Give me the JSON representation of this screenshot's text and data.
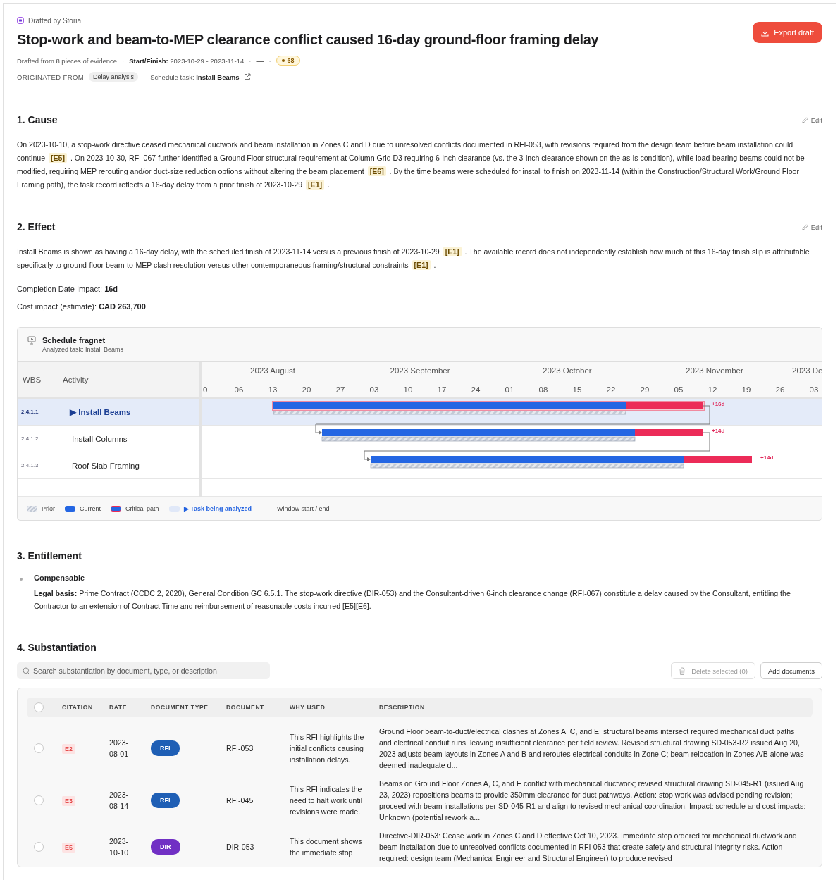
{
  "header": {
    "drafted_by": "Drafted by Storia",
    "title": "Stop-work and beam-to-MEP clearance conflict caused 16-day ground-floor framing delay",
    "export_button": "Export draft",
    "separator": "·",
    "meta": {
      "evidence": "Drafted from 8 pieces of evidence",
      "dates_label": "Start/Finish:",
      "dates": "2023-10-29 - 2023-11-14",
      "dash": "—",
      "score": "68"
    },
    "origin": {
      "label": "ORIGINATED FROM",
      "chip": "Delay analysis",
      "task_label": "Schedule task:",
      "task": "Install Beams"
    }
  },
  "sections": [
    {
      "kind": "text",
      "heading": "1. Cause",
      "edit": "Edit",
      "body": [
        {
          "text": "On 2023-10-10, a stop-work directive ceased mechanical ductwork and beam installation in Zones C and D due to unresolved conflicts documented in RFI-053, with revisions required from the design team before beam installation could continue "
        },
        {
          "cite": "[E5]"
        },
        {
          "text": " . On 2023-10-30, RFI-067 further identified a Ground Floor structural requirement at Column Grid D3 requiring 6-inch clearance (vs. the 3-inch clearance shown on the as-is condition), while load-bearing beams could not be modified, requiring MEP rerouting and/or duct-size reduction options without altering the beam placement "
        },
        {
          "cite": "[E6]"
        },
        {
          "text": " . By the time beams were scheduled for install to finish on 2023-11-14 (within the Construction/Structural Work/Ground Floor Framing path), the task record reflects a 16-day delay from a prior finish of 2023-10-29 "
        },
        {
          "cite": "[E1]"
        },
        {
          "text": " ."
        }
      ]
    },
    {
      "kind": "effect",
      "heading": "2. Effect",
      "edit": "Edit",
      "body": [
        {
          "text": "Install Beams is shown as having a 16-day delay, with the scheduled finish of 2023-11-14 versus a previous finish of 2023-10-29 "
        },
        {
          "cite": "[E1]"
        },
        {
          "text": " . The available record does not independently establish how much of this 16-day finish slip is attributable specifically to ground-floor beam-to-MEP clash resolution versus other contemporaneous framing/structural constraints "
        },
        {
          "cite": "[E1]"
        },
        {
          "text": " ."
        }
      ],
      "facts": [
        "Completion Date Impact: **16d**",
        "Cost impact (estimate): **CAD 263,700**"
      ],
      "gantt": {
        "title": "Schedule fragnet",
        "subtitle": "Analyzed task: Install Beams",
        "columns": [
          "WBS",
          "Activity"
        ],
        "months": [
          "2023 August",
          "2023 September",
          "2023 October",
          "2023 November",
          "2023 De"
        ],
        "weeks": [
          "0",
          "06",
          "13",
          "20",
          "27",
          "03",
          "10",
          "17",
          "24",
          "01",
          "08",
          "15",
          "22",
          "29",
          "05",
          "12",
          "19",
          "26",
          "03"
        ],
        "tasks": [
          {
            "wbs": "2.4.1.1",
            "marker": "▶",
            "name": "Install Beams",
            "selected": true,
            "critical": true,
            "linked": false,
            "delay": "+16d"
          },
          {
            "wbs": "2.4.1.2",
            "name": "Install Columns",
            "selected": false,
            "critical": false,
            "linked": true,
            "delay": "+14d"
          },
          {
            "wbs": "2.4.1.3",
            "name": "Roof Slab Framing",
            "selected": false,
            "critical": false,
            "linked": true,
            "delay": "+14d"
          }
        ],
        "legend": [
          {
            "kind": "prior",
            "label": "Prior"
          },
          {
            "kind": "current",
            "label": "Current"
          },
          {
            "kind": "critical",
            "label": "Critical path"
          },
          {
            "kind": "analyzed",
            "label": "▶ Task being analyzed"
          },
          {
            "kind": "window",
            "label": "Window start / end"
          }
        ]
      }
    },
    {
      "kind": "entitlement",
      "heading": "3. Entitlement",
      "items": [
        {
          "title": "Compensable",
          "text": "**Legal basis:** Prime Contract (CCDC 2, 2020), General Condition GC 6.5.1. The stop-work directive (DIR-053) and the Consultant-driven 6-inch clearance change (RFI-067) constitute a delay caused by the Consultant, entitling the Contractor to an extension of Contract Time and reimbursement of reasonable costs incurred [E5][E6]."
        }
      ]
    },
    {
      "kind": "substantiation",
      "heading": "4. Substantiation",
      "search": {
        "placeholder": "Search substantiation by document, type, or description"
      },
      "delete_button": {
        "label": "Delete selected (0)",
        "disabled": true
      },
      "add_button": "Add documents",
      "table": {
        "all_checked": false,
        "columns": [
          "CITATION",
          "DATE",
          "DOCUMENT TYPE",
          "DOCUMENT",
          "WHY USED",
          "DESCRIPTION"
        ],
        "rows": [
          {
            "checked": false,
            "citation": "E2",
            "date": "2023-08-01",
            "type": "RFI",
            "color": "#1f5fb5",
            "document": "RFI-053",
            "why": "This RFI highlights the initial conflicts causing installation delays.",
            "description": "Ground Floor beam-to-duct/electrical clashes at Zones A, C, and E: structural beams intersect required mechanical duct paths and electrical conduit runs, leaving insufficient clearance per field review. Revised structural drawing SD-053-R2 issued Aug 20, 2023 adjusts beam layouts in Zones A and B and reroutes electrical conduits in Zone C; beam relocation in Zones A/B alone was deemed inadequate d..."
          },
          {
            "checked": false,
            "citation": "E3",
            "date": "2023-08-14",
            "type": "RFI",
            "color": "#1f5fb5",
            "document": "RFI-045",
            "why": "This RFI indicates the need to halt work until revisions were made.",
            "description": "Beams on Ground Floor Zones A, C, and E conflict with mechanical ductwork; revised structural drawing SD-045-R1 (issued Aug 23, 2023) repositions beams to provide 350mm clearance for duct pathways. Action: stop work was advised pending revision; proceed with beam installations per SD-045-R1 and align to revised mechanical coordination. Impact: schedule and cost impacts: Unknown (potential rework a..."
          },
          {
            "checked": false,
            "citation": "E5",
            "date": "2023-10-10",
            "type": "DIR",
            "color": "#7130c4",
            "document": "DIR-053",
            "why": "This document shows the immediate stop",
            "description": "Directive-DIR-053: Cease work in Zones C and D effective Oct 10, 2023. Immediate stop ordered for mechanical ductwork and beam installation due to unresolved conflicts documented in RFI-053 that create safety and structural integrity risks. Action required: design team (Mechanical Engineer and Structural Engineer) to produce revised"
          }
        ]
      }
    }
  ]
}
